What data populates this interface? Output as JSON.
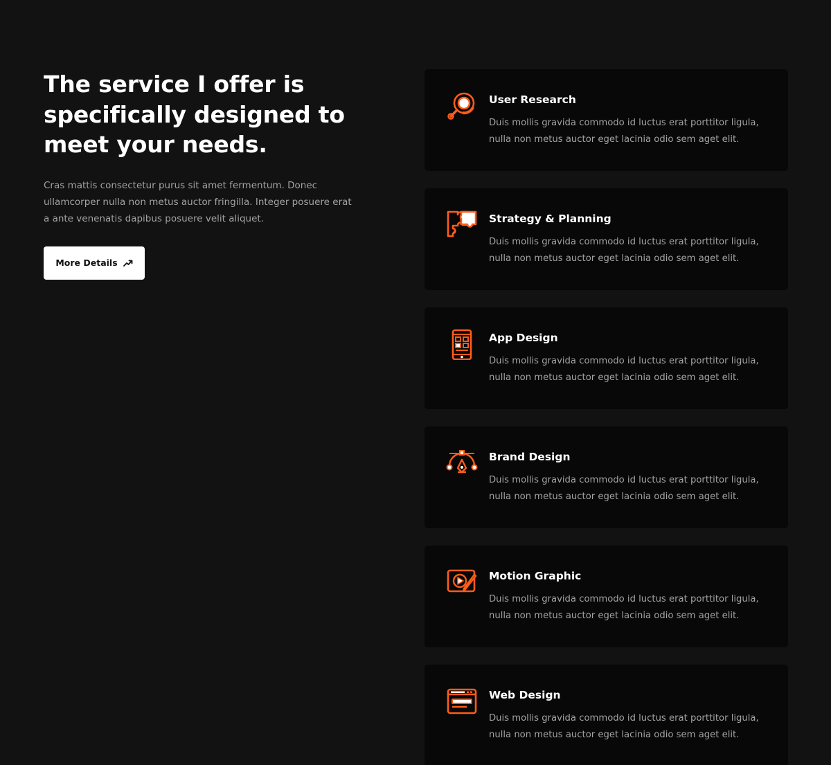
{
  "hero": {
    "heading_line1": "The service I offer is",
    "heading_line2": "specifically designed to",
    "heading_line3": "meet your needs.",
    "intro": "Cras mattis consectetur purus sit amet fermentum. Donec ullamcorper nulla non metus auctor fringilla. Integer posuere erat a ante venenatis dapibus posuere velit aliquet.",
    "button_label": "More Details",
    "button_icon": "arrow-up-right-icon"
  },
  "colors": {
    "background": "#121212",
    "card": "#080808",
    "accent": "#ff5c1a",
    "muted_text": "#a3a3a3"
  },
  "services": [
    {
      "title": "User Research",
      "description": "Duis mollis gravida commodo id luctus erat porttitor ligula, nulla non metus auctor eget lacinia odio sem aget elit.",
      "icon": "magnifier-icon"
    },
    {
      "title": "Strategy & Planning",
      "description": "Duis mollis gravida commodo id luctus erat porttitor ligula, nulla non metus auctor eget lacinia odio sem aget elit.",
      "icon": "puzzle-icon"
    },
    {
      "title": "App Design",
      "description": "Duis mollis gravida commodo id luctus erat porttitor ligula, nulla non metus auctor eget lacinia odio sem aget elit.",
      "icon": "smartphone-icon"
    },
    {
      "title": "Brand Design",
      "description": "Duis mollis gravida commodo id luctus erat porttitor ligula, nulla non metus auctor eget lacinia odio sem aget elit.",
      "icon": "pen-tool-icon"
    },
    {
      "title": "Motion Graphic",
      "description": "Duis mollis gravida commodo id luctus erat porttitor ligula, nulla non metus auctor eget lacinia odio sem aget elit.",
      "icon": "video-edit-icon"
    },
    {
      "title": "Web Design",
      "description": "Duis mollis gravida commodo id luctus erat porttitor ligula, nulla non metus auctor eget lacinia odio sem aget elit.",
      "icon": "browser-window-icon"
    }
  ]
}
